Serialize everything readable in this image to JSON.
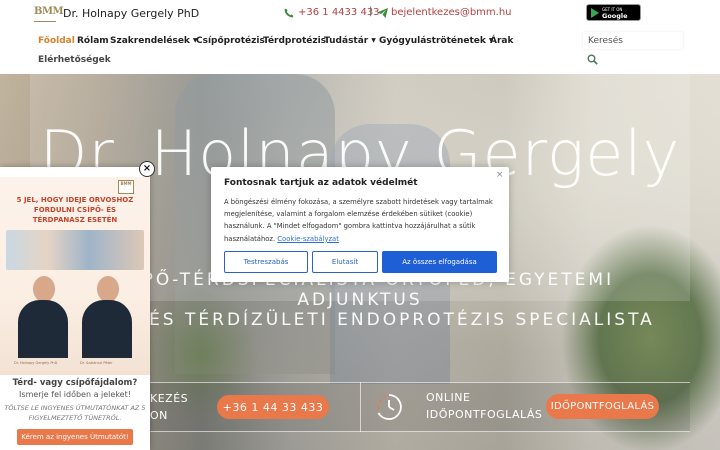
{
  "header": {
    "logo_text": "BMM",
    "site_name": "Dr. Holnapy Gergely PhD",
    "phone": "+36 1 4433 433",
    "separator": "|",
    "email": "bejelentkezes@bmm.hu",
    "google_play": {
      "small": "GET IT ON",
      "big": "Google Play"
    }
  },
  "nav": {
    "items": [
      {
        "label": "Főoldal",
        "active": true
      },
      {
        "label": "Rólam"
      },
      {
        "label": "Szakrendelések",
        "caret": "▼"
      },
      {
        "label": "Csípőprotézis"
      },
      {
        "label": "Térdprotézis"
      },
      {
        "label": "Tudástár",
        "caret": "▼"
      },
      {
        "label": "Gyógyuláströténetek",
        "caret": "▼"
      },
      {
        "label": "Árak"
      },
      {
        "label": "Elérhetőségek"
      }
    ],
    "search_placeholder": "Keresés"
  },
  "hero": {
    "title": "Dr. Holnapy Gergely",
    "subtitle_line1": "CSÍPŐ-TÉRDSPECIALISTA ORTOPÉD, EGYETEMI",
    "subtitle_line2": "ADJUNKTUS",
    "subtitle_line3": "CSÍPŐ- ÉS TÉRDÍZÜLETI ENDOPROTÉZIS SPECIALISTA"
  },
  "cta": {
    "left_line1": "KEZÉS",
    "left_line2": "ON",
    "phone_button": "+36 1 44 33 433",
    "right_line1": "ONLINE",
    "right_line2": "IDŐPONTFOGLALÁS",
    "book_button": "IDŐPONTFOGLALÁS"
  },
  "popup": {
    "close": "×",
    "ebook_logo": "BMM",
    "ebook_title_line1": "5 JEL, HOGY IDEJE ORVOSHOZ",
    "ebook_title_line2": "FORDULNI CSÍPŐ- ÉS",
    "ebook_title_line3": "TÉRDPANASZ ESETÉN",
    "caption_left": "Dr. Holnapy Gergely PhD",
    "caption_right": "Dr. Szalánczi Péter",
    "heading": "Térd- vagy csípőfájdalom?",
    "subheading": "Ismerje fel időben a jeleket!",
    "italic_line1": "TÖLTSE LE INGYENES ÚTMUTATÓNKAT AZ 5",
    "italic_line2": "FIGYELMEZTETŐ TÜNETRŐL.",
    "button": "Kérem az ingyenes Útmutatót!"
  },
  "cookie": {
    "title": "Fontosnak tartjuk az adatok védelmét",
    "close": "×",
    "body": "A böngészési élmény fokozása, a személyre szabott hirdetések vagy tartalmak megjelenítése, valamint a forgalom elemzése érdekében sütiket (cookie) használunk. A \"Mindet elfogadom\" gombra kattintva hozzájárulhat a sütik használatához. ",
    "link": "Cookie-szabályzat",
    "btn_customize": "Testreszabás",
    "btn_reject": "Elutasít",
    "btn_accept": "Az összes elfogadása"
  },
  "colors": {
    "accent_orange": "#e9784a",
    "nav_active": "#d9822b",
    "contact_red": "#b0413e",
    "cookie_blue": "#1f5fd6"
  }
}
